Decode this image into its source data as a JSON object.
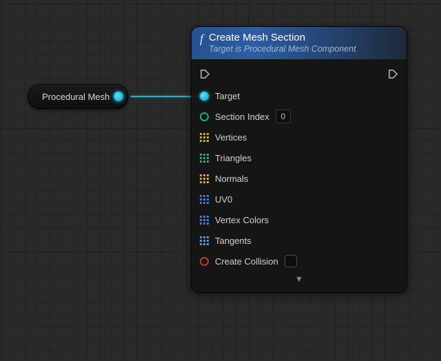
{
  "source_node": {
    "label": "Procedural Mesh"
  },
  "node": {
    "title": "Create Mesh Section",
    "subtitle": "Target is Procedural Mesh Component",
    "pins": {
      "target": "Target",
      "section_index": "Section Index",
      "section_index_value": "0",
      "vertices": "Vertices",
      "triangles": "Triangles",
      "normals": "Normals",
      "uv0": "UV0",
      "vertex_colors": "Vertex Colors",
      "tangents": "Tangents",
      "create_collision": "Create Collision"
    }
  },
  "colors": {
    "wire": "#1bb6d4",
    "header_from": "#28518f",
    "header_to": "#1d2a3a"
  }
}
